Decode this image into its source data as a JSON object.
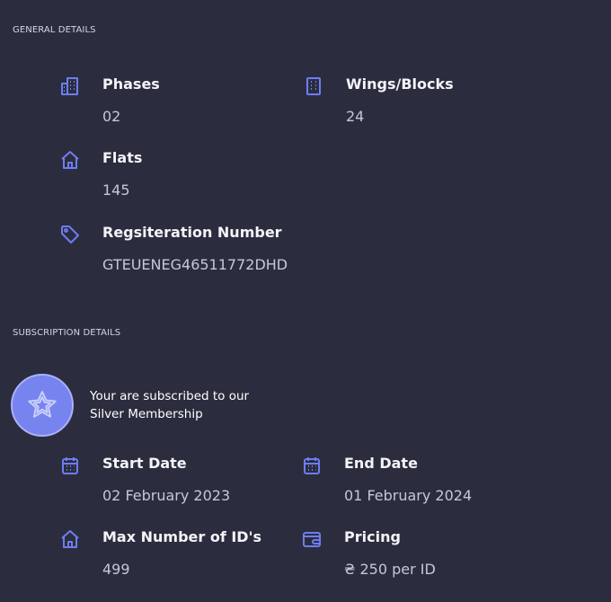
{
  "general": {
    "title": "GENERAL DETAILS",
    "phases": {
      "icon": "building-icon",
      "label": "Phases",
      "value": "02"
    },
    "wings": {
      "icon": "building-blocks-icon",
      "label": "Wings/Blocks",
      "value": "24"
    },
    "flats": {
      "icon": "home-icon",
      "label": "Flats",
      "value": "145"
    },
    "registration": {
      "icon": "tag-icon",
      "label": "Regsiteration Number",
      "value": "GTEUENEG46511772DHD"
    }
  },
  "subscription": {
    "title": "SUBSCRIPTION DETAILS",
    "badge_icon": "star-badge-icon",
    "message_line1": "Your are subscribed to our",
    "message_line2": "Silver Membership",
    "start_date": {
      "icon": "calendar-icon",
      "label": "Start Date",
      "value": "02 February 2023"
    },
    "end_date": {
      "icon": "calendar-icon",
      "label": "End Date",
      "value": "01 February 2024"
    },
    "max_ids": {
      "icon": "home-icon",
      "label": "Max Number of ID's",
      "value": "499"
    },
    "pricing": {
      "icon": "wallet-icon",
      "label": "Pricing",
      "value": "₴ 250 per ID"
    }
  },
  "colors": {
    "background": "#2b2d3e",
    "accent": "#6e7df2",
    "badge": "#7784f0",
    "label": "#f3f4f8",
    "value": "#c5c8d6"
  }
}
